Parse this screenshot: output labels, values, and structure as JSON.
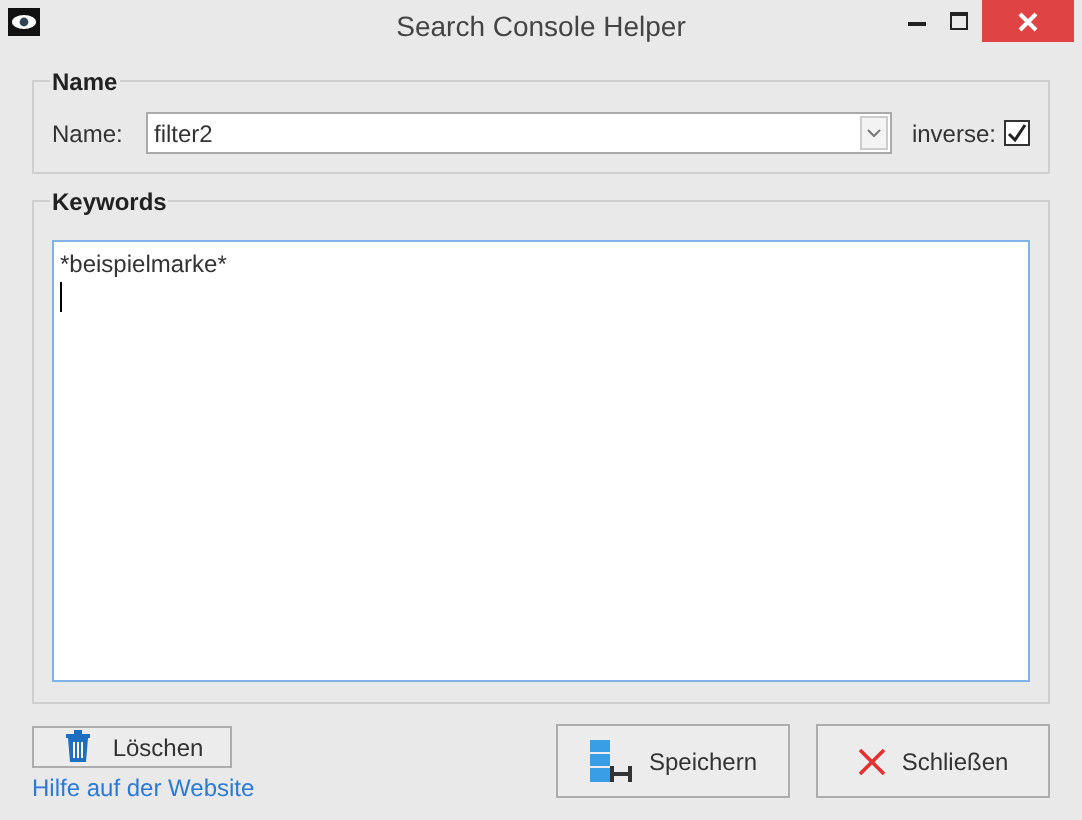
{
  "window": {
    "title": "Search Console Helper"
  },
  "name_group": {
    "title": "Name",
    "label": "Name:",
    "value": "filter2",
    "inverse": {
      "label": "inverse:",
      "checked": true
    }
  },
  "keywords_group": {
    "title": "Keywords",
    "text": "*beispielmarke*",
    "cursor": true
  },
  "buttons": [
    {
      "kind": "delete",
      "label": "Löschen"
    },
    {
      "kind": "save",
      "label": "Speichern"
    },
    {
      "kind": "close",
      "label": "Schließen"
    }
  ],
  "help_link": "Hilfe auf der Website"
}
